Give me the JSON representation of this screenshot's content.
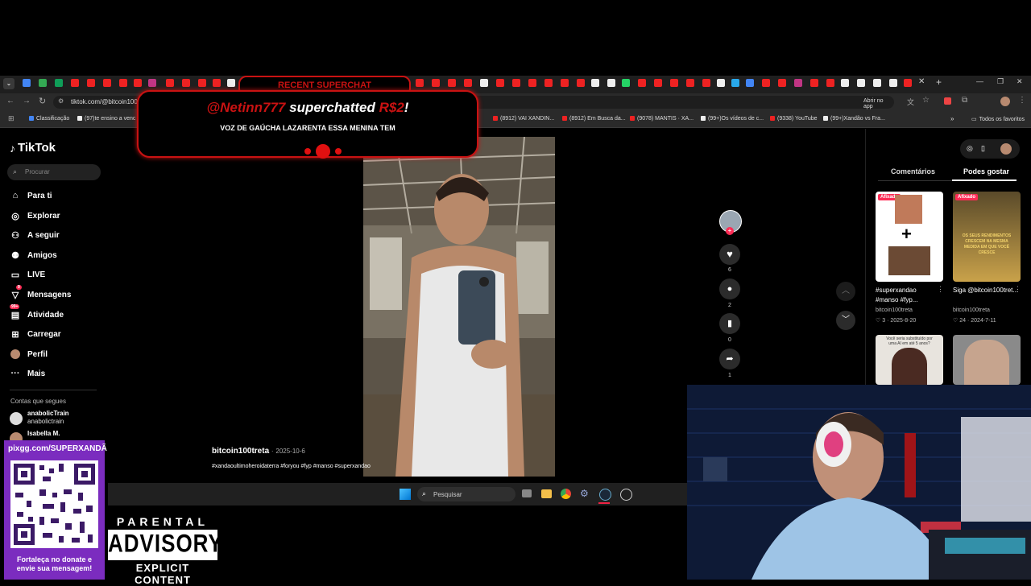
{
  "browser": {
    "url": "tiktok.com/@bitcoin100",
    "open_in_app": "Abrir no app",
    "bookmarks": [
      "Classificação",
      "(97)te ensino a venc",
      "(8912) VAI XANDIN...",
      "(8912) Em Busca da...",
      "(9078) MANTIS · XA...",
      "(99+)Os vídeos de c...",
      "(9338) YouTube",
      "(99+)Xandão vs Fra..."
    ],
    "all_bookmarks": "Todos os favoritos"
  },
  "overlay": {
    "recent_label": "RECENT SUPERCHAT",
    "user": "@Netinn777",
    "action": "superchatted",
    "amount": "R$2",
    "exclaim": "!",
    "message": "VOZ DE GAÚCHA LAZARENTA ESSA MENINA TEM",
    "qr_url": "pixgg.com/SUPERXANDÃ",
    "qr_caption": "Fortaleça no donate e envie sua mensagem!",
    "advisory_top": "PARENTAL",
    "advisory_mid": "ADVISORY",
    "advisory_bot": "EXPLICIT CONTENT"
  },
  "tiktok": {
    "brand": "TikTok",
    "search_placeholder": "Procurar",
    "nav": [
      {
        "label": "Para ti",
        "icon": "home-icon"
      },
      {
        "label": "Explorar",
        "icon": "compass-icon"
      },
      {
        "label": "A seguir",
        "icon": "following-icon"
      },
      {
        "label": "Amigos",
        "icon": "friends-icon"
      },
      {
        "label": "LIVE",
        "icon": "live-icon"
      },
      {
        "label": "Mensagens",
        "icon": "message-icon",
        "badge": "9"
      },
      {
        "label": "Atividade",
        "icon": "activity-icon",
        "badge": "99+"
      },
      {
        "label": "Carregar",
        "icon": "upload-icon"
      },
      {
        "label": "Perfil",
        "icon": "profile-icon"
      },
      {
        "label": "Mais",
        "icon": "more-icon"
      }
    ],
    "following_header": "Contas que segues",
    "following": [
      {
        "name": "anabolicTrain",
        "handle": "anabolictrain"
      },
      {
        "name": "Isabella M.",
        "handle": ""
      }
    ],
    "video": {
      "author": "bitcoin100treta",
      "date": "2025-10-6",
      "caption": "#xandaoultimoheroidaterra #foryou #fyp #manso #superxandao"
    },
    "actions": {
      "likes": "6",
      "comments": "2",
      "saves": "0",
      "shares": "1"
    },
    "right_tabs": [
      "Comentários",
      "Podes gostar"
    ],
    "pinned_label": "Afixado",
    "cards": [
      {
        "title": "#superxandao #manso #fyp...",
        "author": "bitcoin100treta",
        "likes": "3",
        "date": "2025-8-20"
      },
      {
        "title": "Siga @bitcoin100tret...",
        "author": "bitcoin100treta",
        "likes": "24",
        "date": "2024-7-11"
      }
    ],
    "card2_overlay": "OS SEUS RENDIMENTOS CRESCEM NA MESMA MEDIDA EM QUE VOCÊ CRESCE",
    "card3_text": "Você seria substituído por uma AI em até 5 anos?"
  },
  "taskbar": {
    "search_placeholder": "Pesquisar"
  },
  "colors": {
    "accent": "#fe2c55",
    "superchat_red": "#c91212",
    "qr_purple": "#7b2cbf"
  }
}
